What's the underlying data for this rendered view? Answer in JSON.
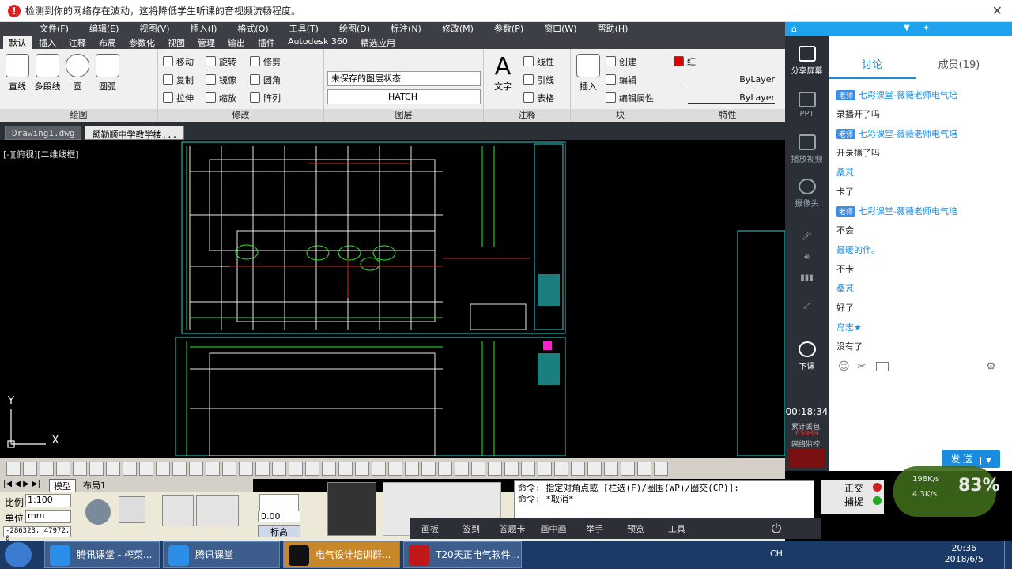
{
  "warning": {
    "text": "检测到你的网络存在波动，这将降低学生听课的音视频流畅程度。"
  },
  "menu": [
    "文件(F)",
    "编辑(E)",
    "视图(V)",
    "插入(I)",
    "格式(O)",
    "工具(T)",
    "绘图(D)",
    "标注(N)",
    "修改(M)",
    "参数(P)",
    "窗口(W)",
    "帮助(H)"
  ],
  "ribbon_tabs": [
    "默认",
    "插入",
    "注释",
    "布局",
    "参数化",
    "视图",
    "管理",
    "输出",
    "插件",
    "Autodesk 360",
    "精选应用"
  ],
  "ribbon": {
    "draw": {
      "title": "绘图",
      "line": "直线",
      "polyline": "多段线",
      "circle": "圆",
      "arc": "圆弧"
    },
    "modify": {
      "title": "修改",
      "move": "移动",
      "rotate": "旋转",
      "trim": "修剪",
      "copy": "复制",
      "mirror": "镜像",
      "fillet": "圆角",
      "stretch": "拉伸",
      "scale": "缩放",
      "array": "阵列"
    },
    "layers": {
      "title": "图层",
      "state": "未保存的图层状态",
      "current": "HATCH"
    },
    "annotation": {
      "title": "注释",
      "text": "文字",
      "linear": "线性",
      "leader": "引线",
      "table": "表格"
    },
    "block": {
      "title": "块",
      "insert": "插入",
      "create": "创建",
      "edit": "编辑",
      "edit_attr": "编辑属性"
    },
    "properties": {
      "title": "特性",
      "color": "红",
      "linetype": "ByLayer",
      "lineweight": "ByLayer"
    }
  },
  "doc_tabs": [
    "Drawing1.dwg",
    "额勒顺中学教学楼..."
  ],
  "view_label": "[-][俯视][二维线框]",
  "layout_tabs": [
    "模型",
    "布局1"
  ],
  "tangent": {
    "scale_label": "比例",
    "scale_value": "1:100",
    "unit_label": "单位",
    "unit_value": "mm",
    "coords": "-286323, 47972, 0",
    "elev_value": "0.00",
    "elev_label": "标高"
  },
  "command": [
    "命令: 指定对角点或 [栏选(F)/圈围(WP)/圈交(CP)]:",
    "命令: *取消*"
  ],
  "status_right": {
    "ortho": "正交",
    "snap": "捕捉"
  },
  "classroom_bar": [
    "画板",
    "签到",
    "答题卡",
    "画中画",
    "举手",
    "预览",
    "工具"
  ],
  "side": {
    "tools": [
      "分享屏幕",
      "PPT",
      "播放视频",
      "摄像头",
      "下课"
    ],
    "timer": "00:18:34",
    "loss_label": "累计丢包:",
    "loss_value": "65989",
    "net_label": "网络监控:",
    "tabs": [
      "讨论",
      "成员(19)"
    ],
    "send": "发 送"
  },
  "messages": [
    {
      "teacher": true,
      "name": "七彩课堂-薇薇老师电气培",
      "text": "录播开了吗"
    },
    {
      "teacher": true,
      "name": "七彩课堂-薇薇老师电气培",
      "text": "开录播了吗"
    },
    {
      "teacher": false,
      "name": "桑芃",
      "text": "卡了"
    },
    {
      "teacher": true,
      "name": "七彩课堂-薇薇老师电气培",
      "text": "不会"
    },
    {
      "teacher": false,
      "name": "最暖的伴。",
      "text": "不卡"
    },
    {
      "teacher": false,
      "name": "桑芃",
      "text": "好了"
    },
    {
      "teacher": false,
      "name": "岛志★",
      "text": "没有了"
    }
  ],
  "teacher_tag": "老师",
  "netspeed": {
    "up": "198K/s",
    "down": "4.3K/s",
    "percent": "83%"
  },
  "taskbar": {
    "tasks": [
      "腾讯课堂 - 榨菜...",
      "腾讯课堂",
      "电气设计培训群...",
      "T20天正电气软件..."
    ],
    "time": "20:36",
    "date": "2018/6/5",
    "lang": "CH"
  }
}
